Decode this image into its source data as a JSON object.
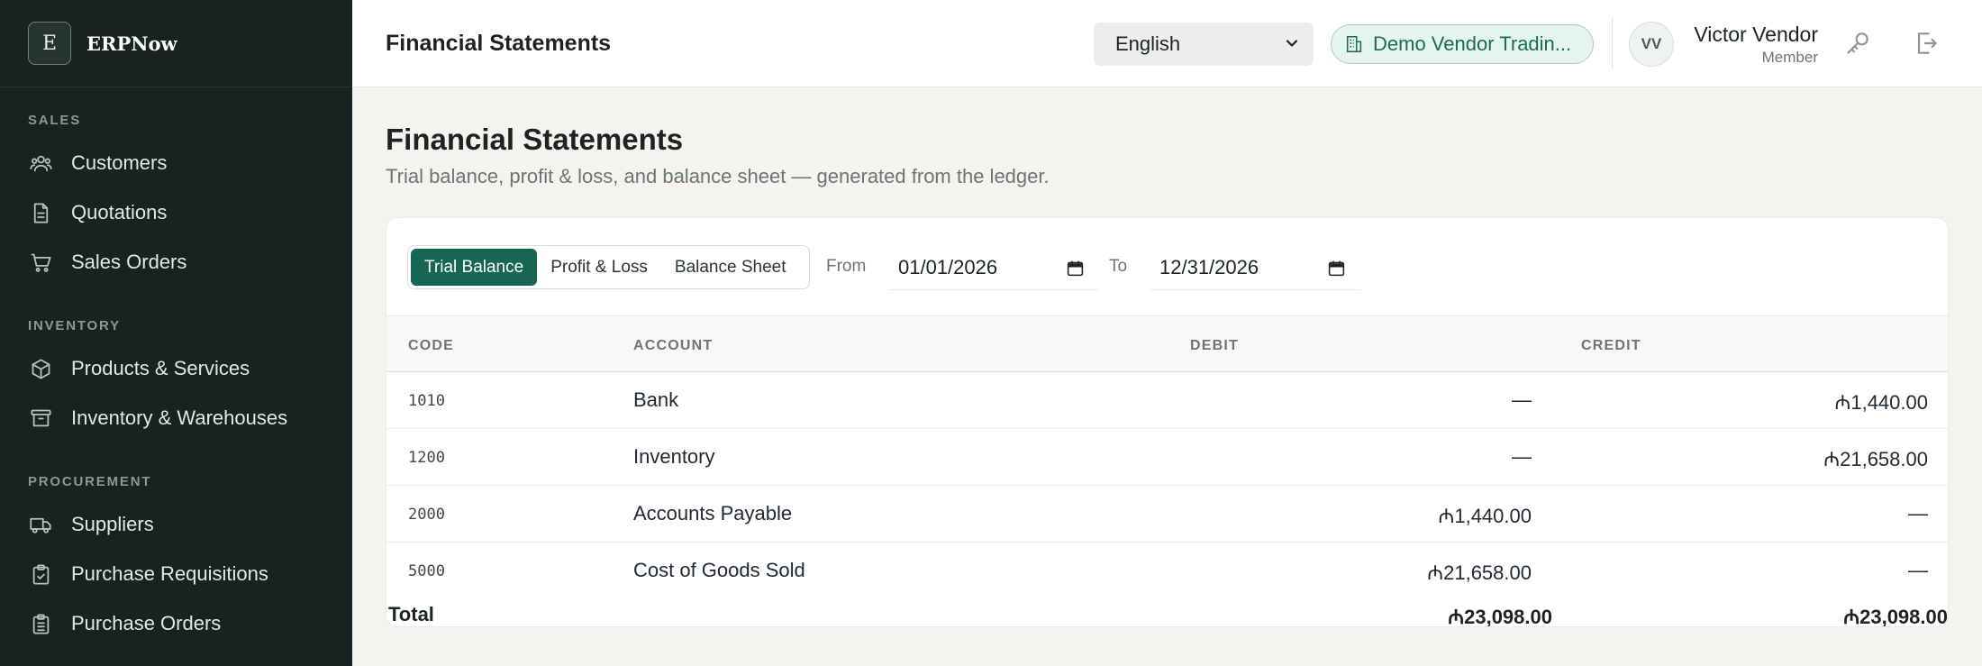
{
  "brand": {
    "logo_letter": "E",
    "name": "ERPNow"
  },
  "sidebar": {
    "sections": [
      {
        "title": "SALES",
        "items": [
          "Customers",
          "Quotations",
          "Sales Orders"
        ]
      },
      {
        "title": "INVENTORY",
        "items": [
          "Products & Services",
          "Inventory & Warehouses"
        ]
      },
      {
        "title": "PROCUREMENT",
        "items": [
          "Suppliers",
          "Purchase Requisitions",
          "Purchase Orders"
        ]
      }
    ]
  },
  "header": {
    "title": "Financial Statements",
    "language": "English",
    "company": "Demo Vendor Tradin...",
    "user": {
      "initials": "VV",
      "name": "Victor Vendor",
      "role": "Member"
    }
  },
  "page": {
    "title": "Financial Statements",
    "subtitle": "Trial balance, profit & loss, and balance sheet — generated from the ledger."
  },
  "toolbar": {
    "tabs": [
      "Trial Balance",
      "Profit & Loss",
      "Balance Sheet"
    ],
    "active_tab": "Trial Balance",
    "from_label": "From",
    "from_value": "01/01/2026",
    "to_label": "To",
    "to_value": "12/31/2026"
  },
  "table": {
    "columns": [
      "CODE",
      "ACCOUNT",
      "DEBIT",
      "CREDIT"
    ],
    "rows": [
      {
        "code": "1010",
        "account": "Bank",
        "debit": "—",
        "credit": "₼1,440.00"
      },
      {
        "code": "1200",
        "account": "Inventory",
        "debit": "—",
        "credit": "₼21,658.00"
      },
      {
        "code": "2000",
        "account": "Accounts Payable",
        "debit": "₼1,440.00",
        "credit": "—"
      },
      {
        "code": "5000",
        "account": "Cost of Goods Sold",
        "debit": "₼21,658.00",
        "credit": "—"
      }
    ],
    "total": {
      "label": "Total",
      "debit": "₼23,098.00",
      "credit": "₼23,098.00"
    }
  },
  "colors": {
    "sidebar_bg": "#172320",
    "accent": "#176653",
    "chip_bg": "#e6f4ef"
  }
}
